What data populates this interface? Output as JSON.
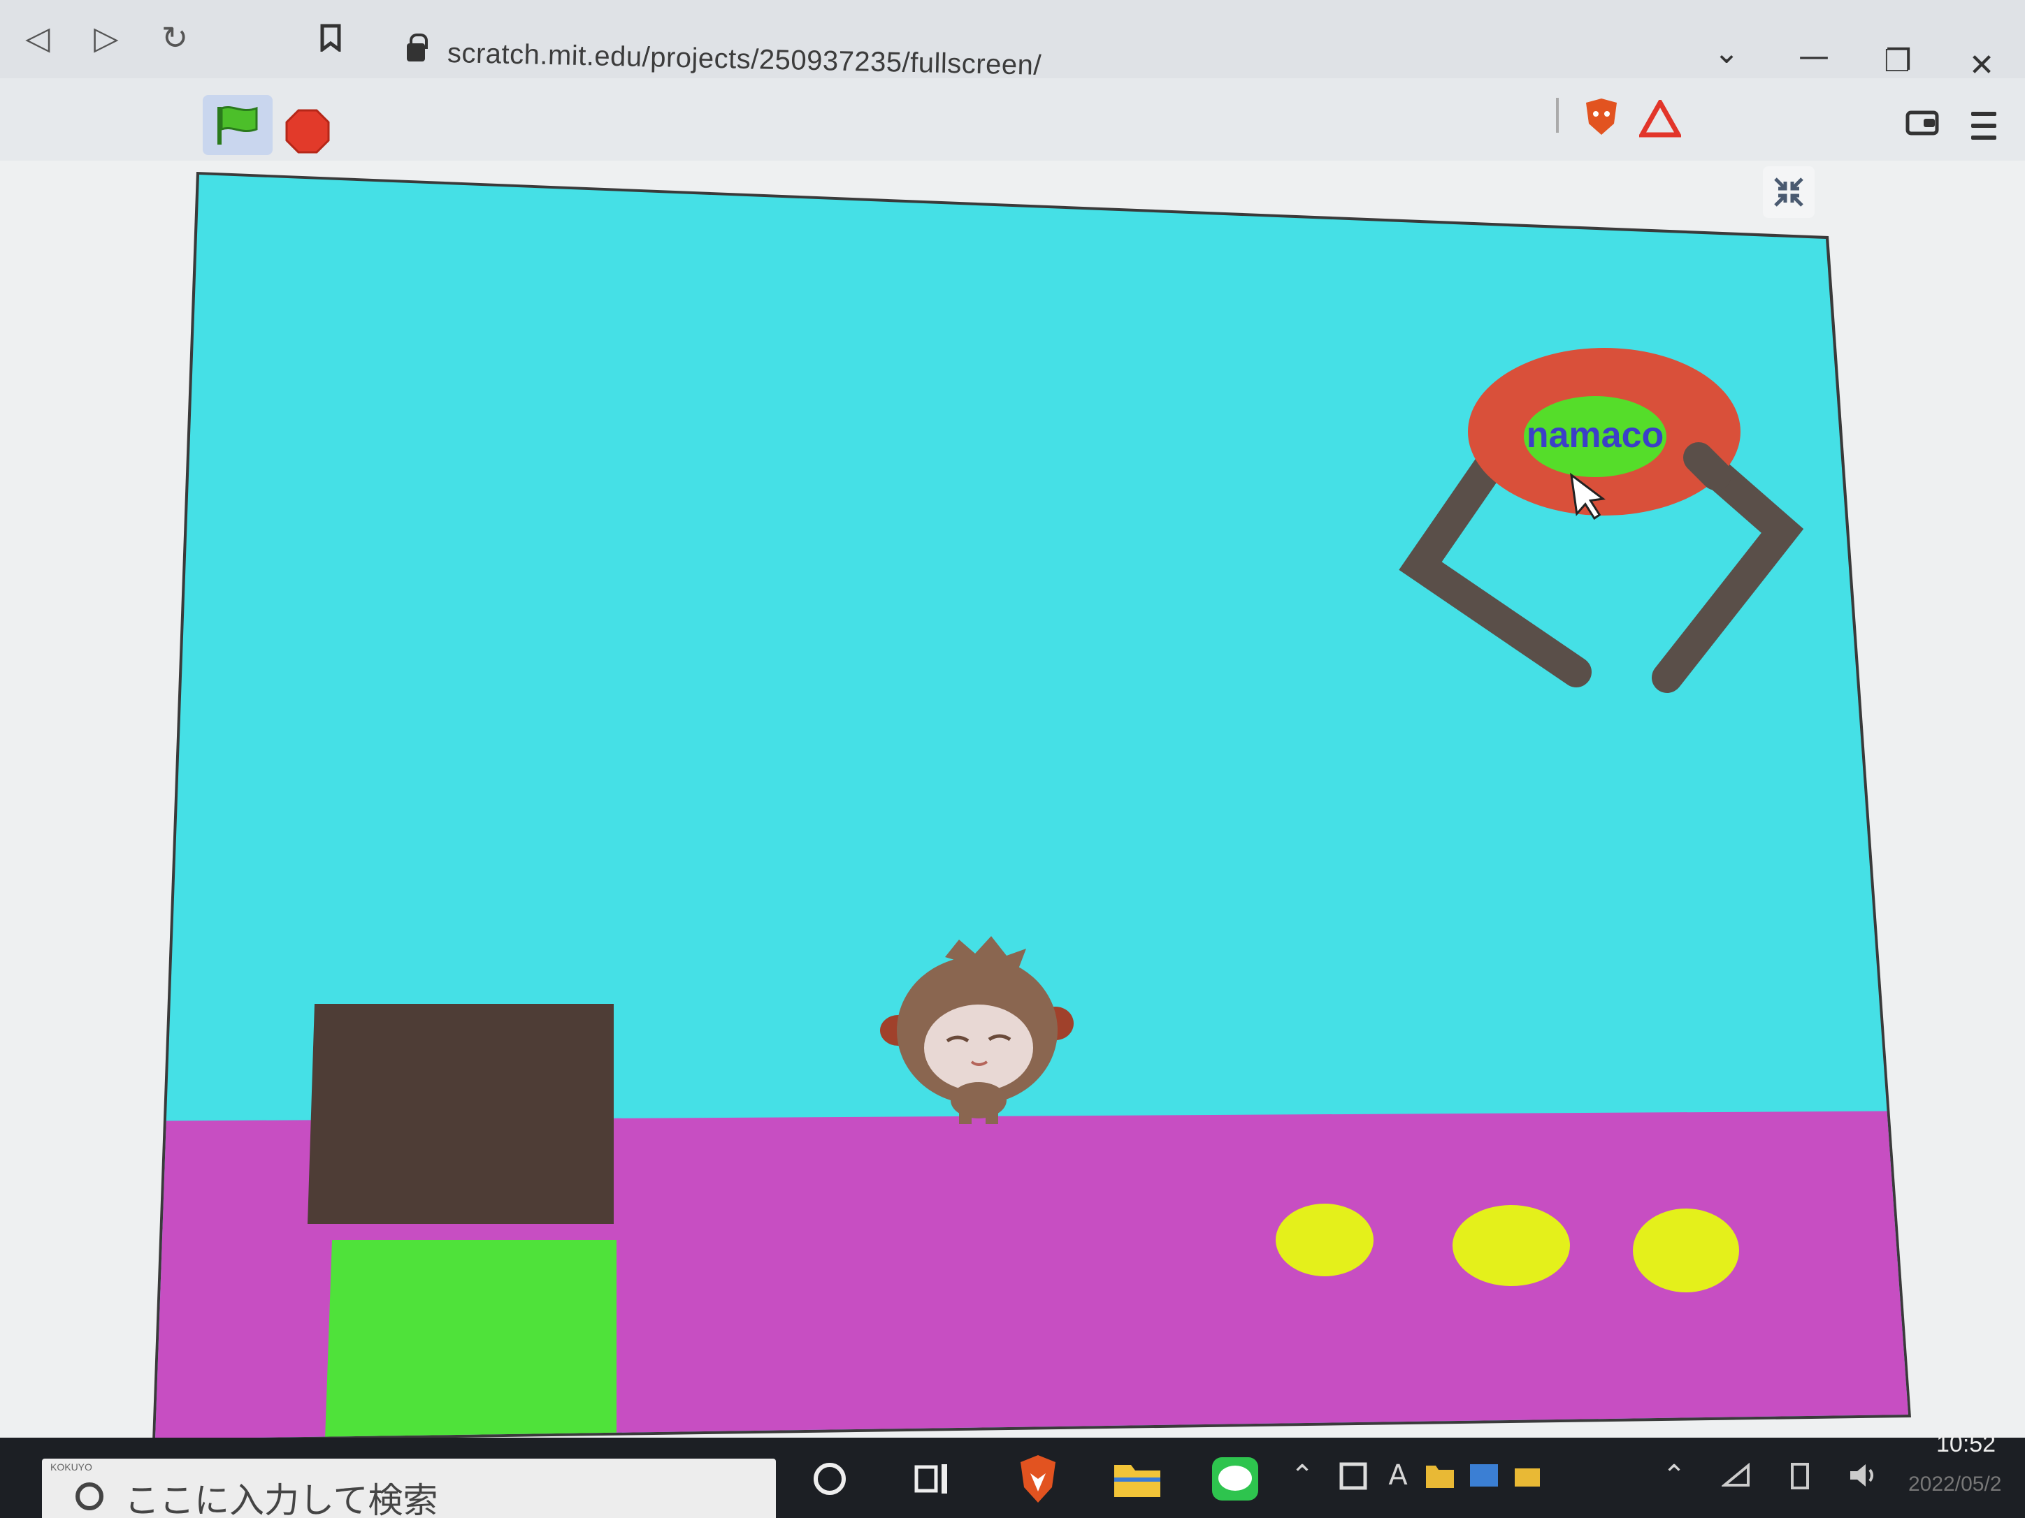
{
  "browser": {
    "url": "scratch.mit.edu/projects/250937235/fullscreen/",
    "window_controls": {
      "dropdown": "⌄",
      "minimize": "—",
      "restore": "❐",
      "close": "✕"
    }
  },
  "toolbar": {
    "green_flag_icon": "green-flag-icon",
    "stop_icon": "stop-sign-icon"
  },
  "stage": {
    "sky_color": "#45e0e6",
    "ground_color": "#c74ec2",
    "sprites": {
      "logo_text": "namaco",
      "logo_outer_color": "#d9503a",
      "logo_inner_color": "#55dd2a",
      "logo_text_color": "#3b3fc8",
      "claw_color": "#5a4f49",
      "dark_block_color": "#4e3d36",
      "green_block_color": "#4fe23a",
      "coin_color": "#e4f01b",
      "coin_count": 3,
      "character": "monkey-sprite"
    }
  },
  "taskbar": {
    "search_placeholder": "ここに入力して検索",
    "sticker_label": "KOKUYO",
    "clock": "10:52",
    "date": "2022/05/2"
  }
}
